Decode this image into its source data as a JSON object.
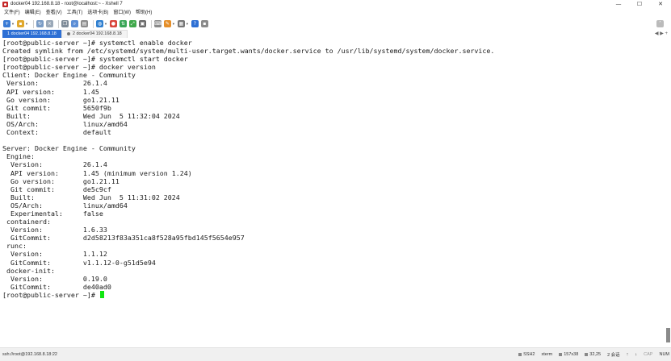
{
  "window": {
    "title": "docker04 192.168.8.18 - root@localhost:~ - Xshell 7",
    "minimize": "—",
    "maximize": "☐",
    "close": "✕"
  },
  "menu": {
    "items": [
      "文件(F)",
      "编辑(E)",
      "查看(V)",
      "工具(T)",
      "选项卡(B)",
      "窗口(W)",
      "帮助(H)"
    ]
  },
  "tabs": [
    {
      "label": "1 docker04 192.168.8.18",
      "active": true
    },
    {
      "label": "2 docker04 192.168.8.18",
      "active": false
    }
  ],
  "tab_nav": "◀ ▶ +",
  "terminal": {
    "lines": [
      "[root@public-server ~]# systemctl enable docker",
      "Created symlink from /etc/systemd/system/multi-user.target.wants/docker.service to /usr/lib/systemd/system/docker.service.",
      "[root@public-server ~]# systemctl start docker",
      "[root@public-server ~]# docker version",
      "Client: Docker Engine - Community",
      " Version:           26.1.4",
      " API version:       1.45",
      " Go version:        go1.21.11",
      " Git commit:        5650f9b",
      " Built:             Wed Jun  5 11:32:04 2024",
      " OS/Arch:           linux/amd64",
      " Context:           default",
      "",
      "Server: Docker Engine - Community",
      " Engine:",
      "  Version:          26.1.4",
      "  API version:      1.45 (minimum version 1.24)",
      "  Go version:       go1.21.11",
      "  Git commit:       de5c9cf",
      "  Built:            Wed Jun  5 11:31:02 2024",
      "  OS/Arch:          linux/amd64",
      "  Experimental:     false",
      " containerd:",
      "  Version:          1.6.33",
      "  GitCommit:        d2d58213f83a351ca8f528a95fbd145f5654e957",
      " runc:",
      "  Version:          1.1.12",
      "  GitCommit:        v1.1.12-0-g51d5e94",
      " docker-init:",
      "  Version:          0.19.0",
      "  GitCommit:        de40ad0"
    ],
    "prompt": "[root@public-server ~]# ",
    "cursor_color": "#11e611"
  },
  "status": {
    "connection": "ssh://root@192.168.8.18:22",
    "protocol": "SSH2",
    "term": "xterm",
    "size": "157x38",
    "cursor_pos": "32,25",
    "sessions": "2 会话",
    "caps": "CAP",
    "num": "NUM"
  },
  "toolbar": {
    "icons": [
      "new-session-icon",
      "open-folder-icon",
      "reconnect-icon",
      "disconnect-icon",
      "copy-icon",
      "find-icon",
      "print-icon",
      "transfer-icon",
      "globe-icon",
      "color-scheme-icon",
      "xftp-icon",
      "fullscreen-icon",
      "lock-icon",
      "keyboard-icon",
      "compose-icon",
      "layout-icon",
      "help-icon"
    ]
  },
  "colors": {
    "active_tab": "#2d6fd4",
    "terminal_bg": "#ffffff",
    "terminal_fg": "#1a1a1a"
  }
}
